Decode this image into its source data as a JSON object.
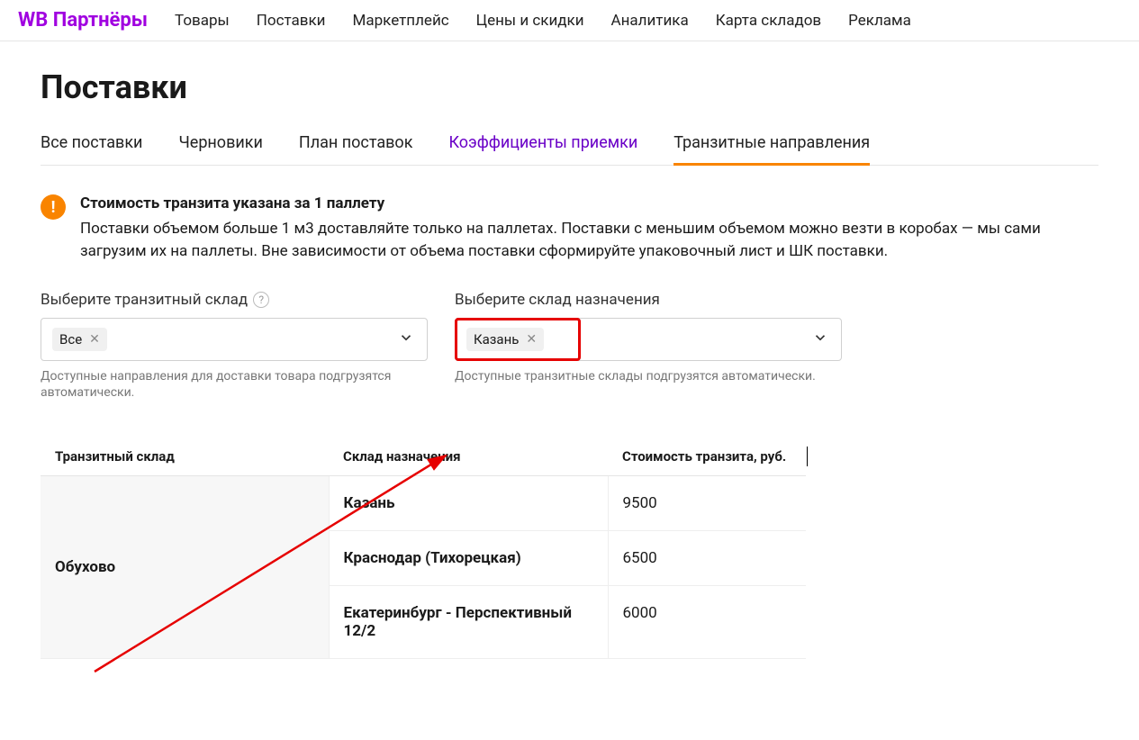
{
  "brand": "WB Партнёры",
  "nav": {
    "items": [
      {
        "label": "Товары"
      },
      {
        "label": "Поставки"
      },
      {
        "label": "Маркетплейс"
      },
      {
        "label": "Цены и скидки"
      },
      {
        "label": "Аналитика"
      },
      {
        "label": "Карта складов"
      },
      {
        "label": "Реклама"
      }
    ]
  },
  "page": {
    "title": "Поставки"
  },
  "tabs": [
    {
      "label": "Все поставки",
      "active": false,
      "link": false
    },
    {
      "label": "Черновики",
      "active": false,
      "link": false
    },
    {
      "label": "План поставок",
      "active": false,
      "link": false
    },
    {
      "label": "Коэффициенты приемки",
      "active": false,
      "link": true
    },
    {
      "label": "Транзитные направления",
      "active": true,
      "link": false
    }
  ],
  "notice": {
    "title": "Стоимость транзита указана за 1 паллету",
    "body": "Поставки объемом больше 1 м3 доставляйте только на паллетах. Поставки с меньшим объемом можно везти в коробах — мы сами загрузим их на паллеты. Вне зависимости от объема поставки сформируйте упаковочный лист и ШК поставки."
  },
  "filters": {
    "transit": {
      "label": "Выберите транзитный склад",
      "chip": "Все",
      "hint": "Доступные направления для доставки товара подгрузятся автоматически."
    },
    "destination": {
      "label": "Выберите склад назначения",
      "chip": "Казань",
      "hint": "Доступные транзитные склады подгрузятся автоматически."
    }
  },
  "table": {
    "headers": {
      "transit": "Транзитный склад",
      "destination": "Склад назначения",
      "cost": "Стоимость транзита, руб."
    },
    "group_transit": "Обухово",
    "rows": [
      {
        "destination": "Казань",
        "cost": "9500"
      },
      {
        "destination": "Краснодар (Тихорецкая)",
        "cost": "6500"
      },
      {
        "destination": "Екатеринбург - Перспективный 12/2",
        "cost": "6000"
      }
    ]
  }
}
